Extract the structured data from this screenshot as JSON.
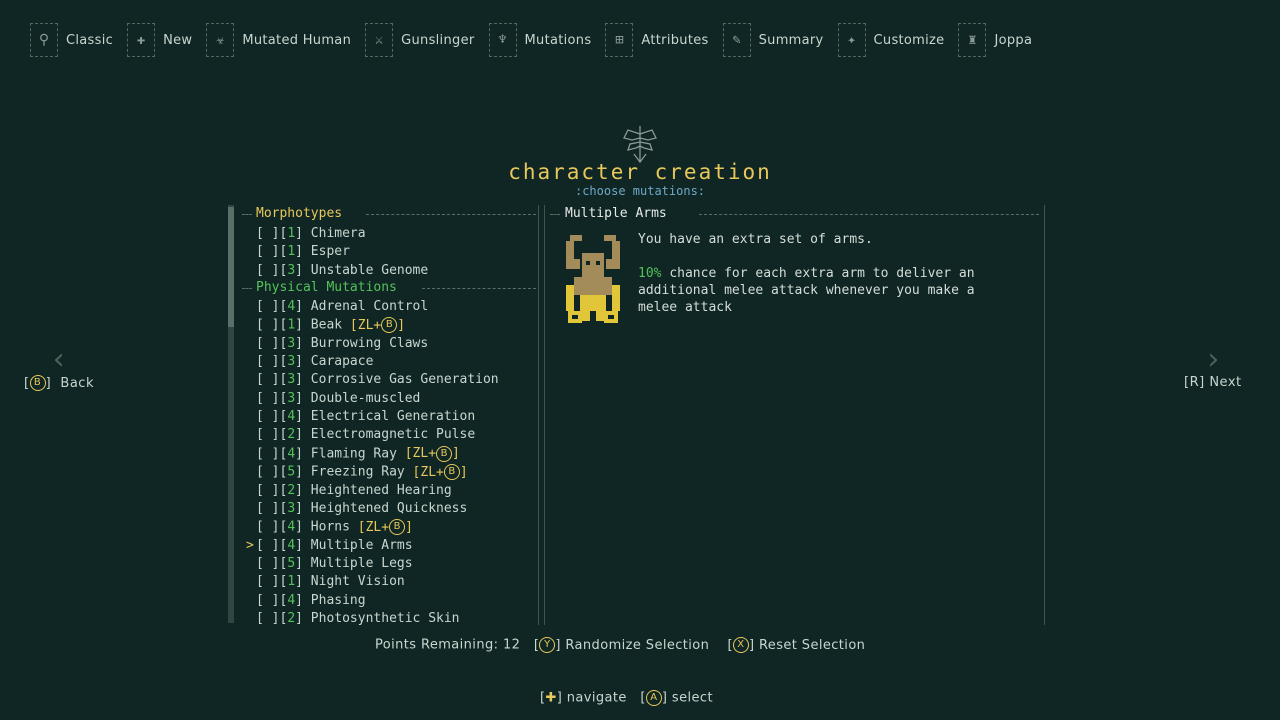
{
  "breadcrumbs": [
    {
      "label": "Classic",
      "icon": "classic-icon"
    },
    {
      "label": "New",
      "icon": "plus-icon"
    },
    {
      "label": "Mutated Human",
      "icon": "mutant-icon"
    },
    {
      "label": "Gunslinger",
      "icon": "gunslinger-icon"
    },
    {
      "label": "Mutations",
      "icon": "mutation-icon"
    },
    {
      "label": "Attributes",
      "icon": "attributes-icon"
    },
    {
      "label": "Summary",
      "icon": "summary-icon"
    },
    {
      "label": "Customize",
      "icon": "customize-icon"
    },
    {
      "label": "Joppa",
      "icon": "joppa-icon"
    }
  ],
  "header": {
    "title": "character creation",
    "subtitle": ":choose mutations:"
  },
  "sections": {
    "morphotypes": "Morphotypes",
    "physical": "Physical Mutations"
  },
  "morphotypes": [
    {
      "check": "[ ]",
      "cost": "1",
      "name": "Chimera"
    },
    {
      "check": "[ ]",
      "cost": "1",
      "name": "Esper"
    },
    {
      "check": "[ ]",
      "cost": "3",
      "name": "Unstable Genome"
    }
  ],
  "physical": [
    {
      "check": "[ ]",
      "cost": "4",
      "name": "Adrenal Control",
      "tag": ""
    },
    {
      "check": "[ ]",
      "cost": "1",
      "name": "Beak",
      "tag": "ZL+"
    },
    {
      "check": "[ ]",
      "cost": "3",
      "name": "Burrowing Claws",
      "tag": ""
    },
    {
      "check": "[ ]",
      "cost": "3",
      "name": "Carapace",
      "tag": ""
    },
    {
      "check": "[ ]",
      "cost": "3",
      "name": "Corrosive Gas Generation",
      "tag": ""
    },
    {
      "check": "[ ]",
      "cost": "3",
      "name": "Double-muscled",
      "tag": ""
    },
    {
      "check": "[ ]",
      "cost": "4",
      "name": "Electrical Generation",
      "tag": ""
    },
    {
      "check": "[ ]",
      "cost": "2",
      "name": "Electromagnetic Pulse",
      "tag": ""
    },
    {
      "check": "[ ]",
      "cost": "4",
      "name": "Flaming Ray",
      "tag": "ZL+"
    },
    {
      "check": "[ ]",
      "cost": "5",
      "name": "Freezing Ray",
      "tag": "ZL+"
    },
    {
      "check": "[ ]",
      "cost": "2",
      "name": "Heightened Hearing",
      "tag": ""
    },
    {
      "check": "[ ]",
      "cost": "3",
      "name": "Heightened Quickness",
      "tag": ""
    },
    {
      "check": "[ ]",
      "cost": "4",
      "name": "Horns",
      "tag": "ZL+"
    },
    {
      "check": "[ ]",
      "cost": "4",
      "name": "Multiple Arms",
      "tag": ""
    },
    {
      "check": "[ ]",
      "cost": "5",
      "name": "Multiple Legs",
      "tag": ""
    },
    {
      "check": "[ ]",
      "cost": "1",
      "name": "Night Vision",
      "tag": ""
    },
    {
      "check": "[ ]",
      "cost": "4",
      "name": "Phasing",
      "tag": ""
    },
    {
      "check": "[ ]",
      "cost": "2",
      "name": "Photosynthetic Skin",
      "tag": ""
    }
  ],
  "cursor": ">",
  "detail": {
    "title": "Multiple Arms",
    "line1": "You have an extra set of arms.",
    "pct": "10%",
    "line2": "chance for each extra arm to deliver an additional melee attack whenever you make a melee attack"
  },
  "nav": {
    "back": "Back",
    "back_button": "B",
    "next": "Next",
    "next_button": "[R]"
  },
  "bottom": {
    "points_label": "Points Remaining:",
    "points_value": "12",
    "randomize_button": "Y",
    "randomize": "Randomize Selection",
    "reset_button": "X",
    "reset": "Reset Selection"
  },
  "controls": {
    "navigate": "navigate",
    "select_button": "A",
    "select": "select"
  },
  "button_glyph_B": "B"
}
